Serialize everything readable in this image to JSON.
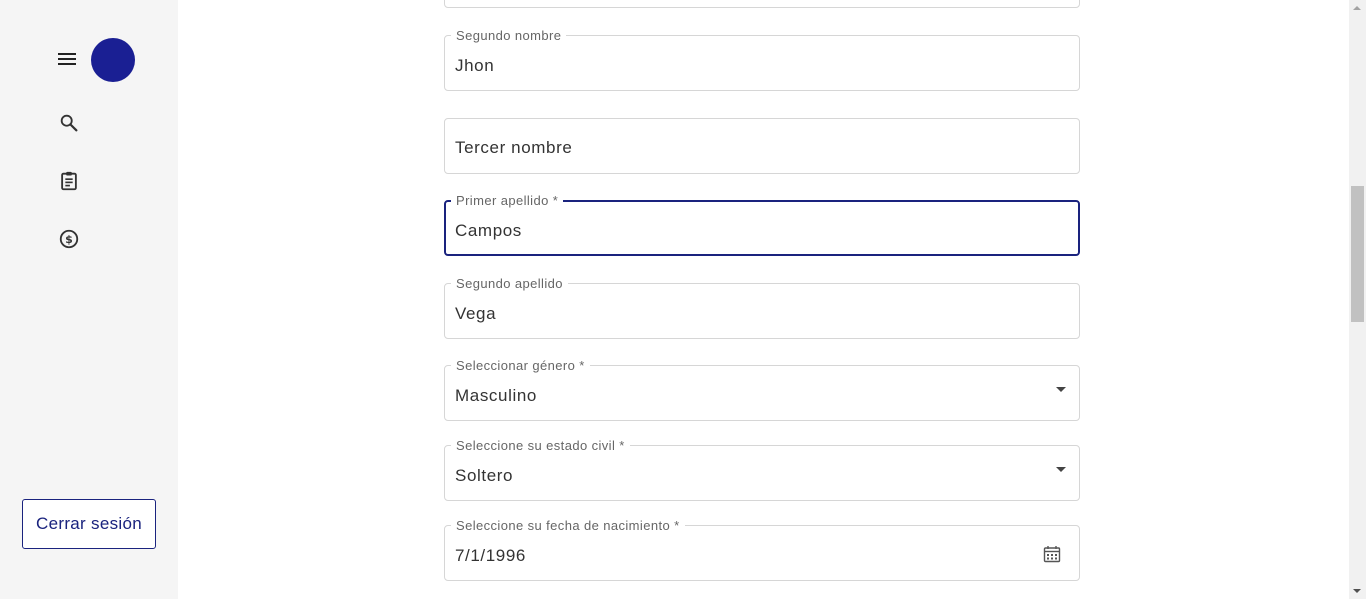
{
  "sidebar": {
    "icons": [
      "menu-icon",
      "search-icon",
      "clipboard-icon",
      "dollar-icon"
    ],
    "avatar_color": "#1a1f93",
    "logout_label": "Cerrar sesión"
  },
  "form": {
    "segundo_nombre": {
      "label": "Segundo nombre",
      "value": "Jhon"
    },
    "tercer_nombre": {
      "placeholder": "Tercer nombre"
    },
    "primer_apellido": {
      "label": "Primer apellido *",
      "value": "Campos"
    },
    "segundo_apellido": {
      "label": "Segundo apellido",
      "value": "Vega"
    },
    "genero": {
      "label": "Seleccionar género *",
      "value": "Masculino"
    },
    "estado_civil": {
      "label": "Seleccione su estado civil *",
      "value": "Soltero"
    },
    "fecha_nacimiento": {
      "label": "Seleccione su fecha de nacimiento *",
      "value": "7/1/1996"
    }
  },
  "colors": {
    "accent": "#1a237e",
    "sidebar_bg": "#f5f5f5"
  }
}
